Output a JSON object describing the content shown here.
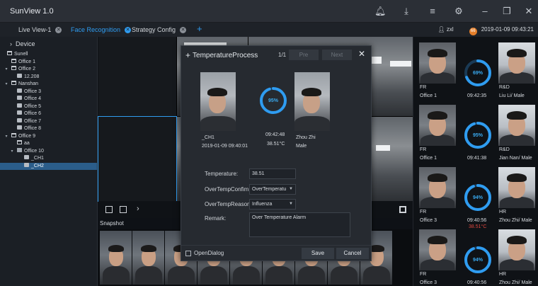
{
  "app": {
    "title": "SunView 1.0"
  },
  "window_controls": {
    "icons": [
      "bell-icon",
      "download-icon",
      "menu-icon",
      "settings-icon",
      "minimize-icon",
      "restore-icon",
      "close-icon"
    ]
  },
  "tabs": [
    {
      "label": "Live View-1",
      "active": false
    },
    {
      "label": "Face Recognition",
      "active": true
    },
    {
      "label": "Strategy Config",
      "active": false
    }
  ],
  "user": {
    "name": "zxl",
    "datetime": "2019-01-09 09:43:21"
  },
  "sidebar": {
    "header": "Device",
    "tree": [
      {
        "label": "Sunell",
        "level": 0,
        "type": "org",
        "arrow": ""
      },
      {
        "label": "Office 1",
        "level": 1,
        "type": "org",
        "arrow": ""
      },
      {
        "label": "Office 2",
        "level": 1,
        "type": "org",
        "arrow": "open"
      },
      {
        "label": "12.208",
        "level": 2,
        "type": "cam",
        "arrow": ""
      },
      {
        "label": "Nanshan",
        "level": 1,
        "type": "org",
        "arrow": "open"
      },
      {
        "label": "Office 3",
        "level": 2,
        "type": "cam",
        "arrow": ""
      },
      {
        "label": "Office 4",
        "level": 2,
        "type": "cam",
        "arrow": ""
      },
      {
        "label": "Office 5",
        "level": 2,
        "type": "cam",
        "arrow": ""
      },
      {
        "label": "Office 6",
        "level": 2,
        "type": "cam",
        "arrow": ""
      },
      {
        "label": "Office 7",
        "level": 2,
        "type": "cam",
        "arrow": ""
      },
      {
        "label": "Office 8",
        "level": 2,
        "type": "cam",
        "arrow": ""
      },
      {
        "label": "Office 9",
        "level": 1,
        "type": "org",
        "arrow": "open"
      },
      {
        "label": "aa",
        "level": 2,
        "type": "org",
        "arrow": ""
      },
      {
        "label": "Office 10",
        "level": 2,
        "type": "nvr",
        "arrow": "open"
      },
      {
        "label": "_CH1",
        "level": 3,
        "type": "cam",
        "arrow": "",
        "selected": false
      },
      {
        "label": "_CH2",
        "level": 3,
        "type": "cam",
        "arrow": "",
        "selected": true
      }
    ]
  },
  "snapshot": {
    "label": "Snapshot"
  },
  "recognition_cards": [
    {
      "percent": "69%",
      "level": 0.69,
      "group": "FR",
      "location": "Office 1",
      "time": "09:42:35",
      "match_group": "R&D",
      "match_name": "Liu Li/ Male",
      "temp": ""
    },
    {
      "percent": "95%",
      "level": 0.95,
      "group": "FR",
      "location": "Office 1",
      "time": "09:41:38",
      "match_group": "R&D",
      "match_name": "Jian Nan/ Male",
      "temp": ""
    },
    {
      "percent": "94%",
      "level": 0.94,
      "group": "FR",
      "location": "Office 3",
      "time": "09:40:56",
      "match_group": "HR",
      "match_name": "Zhou Zhi/ Male",
      "temp": "38.51°C"
    },
    {
      "percent": "94%",
      "level": 0.94,
      "group": "FR",
      "location": "Office 3",
      "time": "09:40:56",
      "match_group": "HR",
      "match_name": "Zhou Zhi/ Male",
      "temp": ""
    }
  ],
  "dialog": {
    "title": "TemperatureProcess",
    "page": "1/1",
    "prev_label": "Pre",
    "next_label": "Next",
    "capture": {
      "percent": "95%",
      "level": 0.95,
      "channel": "_CH1",
      "datetime": "2019-01-09 09:40:01",
      "time": "09:42:48",
      "temp": "38.51°C",
      "match_name": "Zhou Zhi",
      "gender": "Male"
    },
    "fields": {
      "temperature_label": "Temperature:",
      "temperature_value": "38.51",
      "overtemp_confirm_label": "OverTempConfim:",
      "overtemp_confirm_value": "OverTemperatu",
      "overtemp_reason_label": "OverTempReason:",
      "overtemp_reason_value": "Influenza",
      "remark_label": "Remark:",
      "remark_value": "Over Temperature Alarm"
    },
    "open_dialog_label": "OpenDialog",
    "save_label": "Save",
    "cancel_label": "Cancel"
  },
  "colors": {
    "accent": "#2f9cf0",
    "alarm": "#e0473f",
    "selected": "#2b5d8a"
  }
}
